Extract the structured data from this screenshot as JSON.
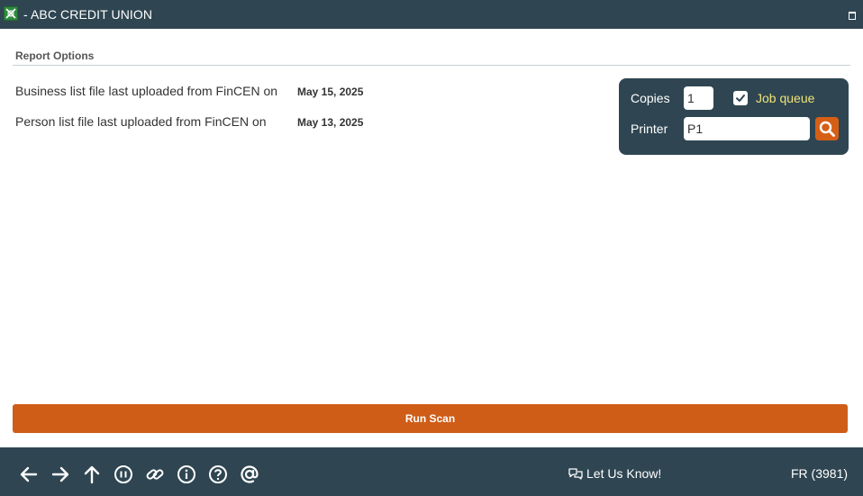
{
  "window": {
    "title": "- ABC CREDIT UNION",
    "app_icon": "app-logo-icon",
    "restore_icon": "restore-window-icon"
  },
  "report_options": {
    "section_title": "Report Options",
    "rows": [
      {
        "label": "Business list file last uploaded from FinCEN on",
        "value": "May 15, 2025"
      },
      {
        "label": "Person list file last uploaded from FinCEN on",
        "value": "May 13, 2025"
      }
    ]
  },
  "print_options": {
    "copies_label": "Copies",
    "copies_value": "1",
    "job_queue_label": "Job queue",
    "job_queue_checked": true,
    "printer_label": "Printer",
    "printer_value": "P1",
    "search_icon": "search-icon"
  },
  "actions": {
    "run_label": "Run Scan"
  },
  "footer": {
    "nav_icons": [
      "back-arrow-icon",
      "forward-arrow-icon",
      "up-arrow-icon",
      "pause-icon",
      "link-icon",
      "info-icon",
      "help-icon",
      "at-sign-icon"
    ],
    "feedback_label": "Let Us Know!",
    "user_code": "FR (3981)"
  },
  "colors": {
    "header_bg": "#2f4652",
    "accent_orange": "#cf5d17",
    "job_queue_text": "#f0e27a"
  }
}
